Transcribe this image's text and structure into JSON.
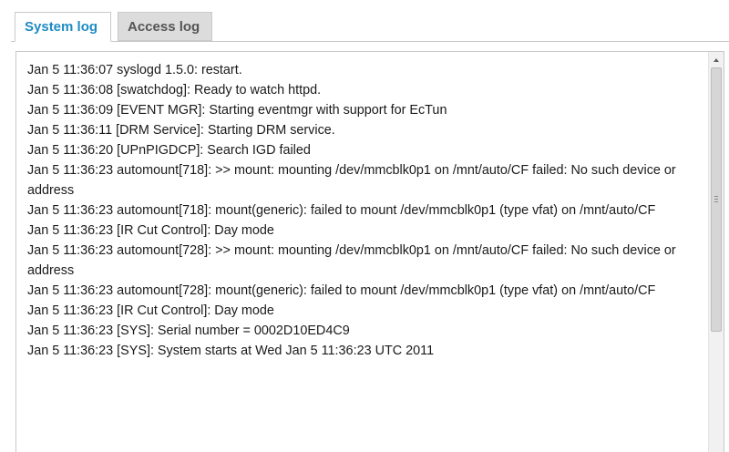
{
  "tabs": {
    "system_log": "System log",
    "access_log": "Access log"
  },
  "log": {
    "lines": [
      "Jan 5 11:36:07 syslogd 1.5.0: restart.",
      "Jan 5 11:36:08 [swatchdog]: Ready to watch httpd.",
      "Jan 5 11:36:09 [EVENT MGR]: Starting eventmgr with support for EcTun",
      "Jan 5 11:36:11 [DRM Service]: Starting DRM service.",
      "Jan 5 11:36:20 [UPnPIGDCP]: Search IGD failed",
      "Jan 5 11:36:23 automount[718]: >> mount: mounting /dev/mmcblk0p1 on /mnt/auto/CF failed: No such device or address",
      "Jan 5 11:36:23 automount[718]: mount(generic): failed to mount /dev/mmcblk0p1 (type vfat) on /mnt/auto/CF",
      "Jan 5 11:36:23 [IR Cut Control]: Day mode",
      "Jan 5 11:36:23 automount[728]: >> mount: mounting /dev/mmcblk0p1 on /mnt/auto/CF failed: No such device or address",
      "Jan 5 11:36:23 automount[728]: mount(generic): failed to mount /dev/mmcblk0p1 (type vfat) on /mnt/auto/CF",
      "Jan 5 11:36:23 [IR Cut Control]: Day mode",
      "Jan 5 11:36:23 [SYS]: Serial number = 0002D10ED4C9",
      "Jan 5 11:36:23 [SYS]: System starts at Wed Jan 5 11:36:23 UTC 2011"
    ]
  },
  "colors": {
    "active_tab_text": "#1e8bc3",
    "inactive_tab_bg": "#dcdcdc",
    "border": "#c9c9c9"
  },
  "icons": {
    "scroll_up": "scroll-up-arrow-icon"
  }
}
